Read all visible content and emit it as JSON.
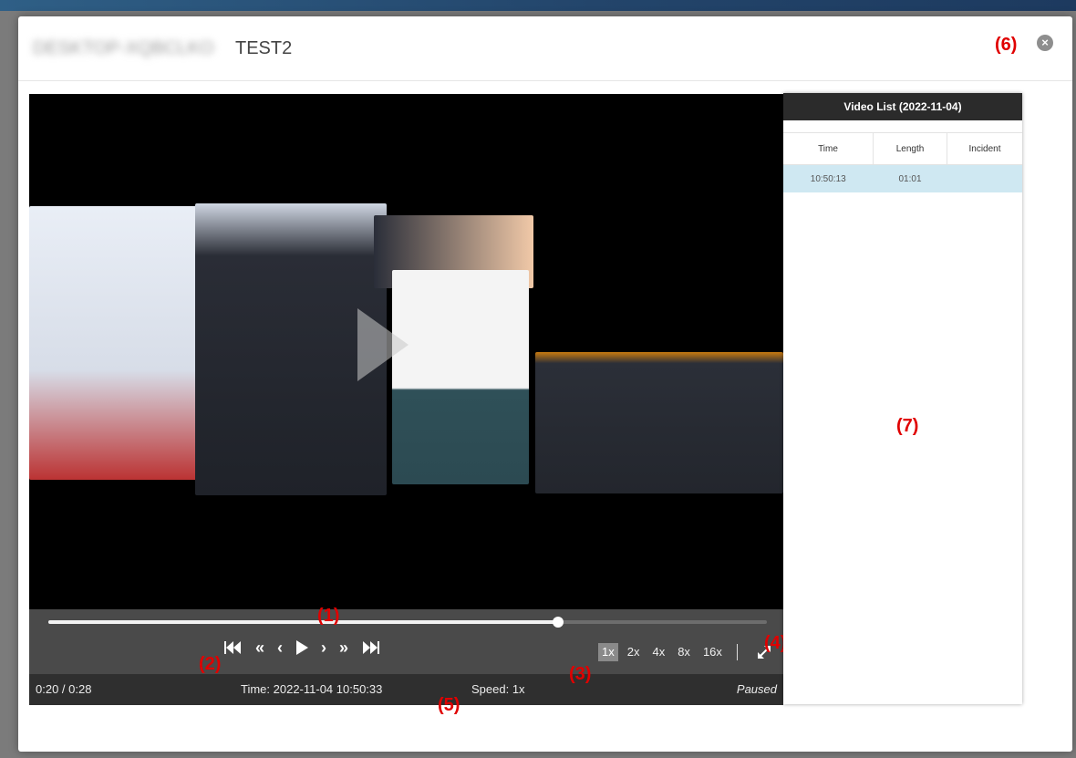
{
  "modal": {
    "computer_name": "DESKTOP-XQBCLKO",
    "title": "TEST2",
    "close_icon": "close-icon"
  },
  "callouts": {
    "c1": "(1)",
    "c2": "(2)",
    "c3": "(3)",
    "c4": "(4)",
    "c5": "(5)",
    "c6": "(6)",
    "c7": "(7)"
  },
  "player": {
    "progress": 0.71,
    "transport": [
      "skip-to-start-icon",
      "rewind-icon",
      "step-back-icon",
      "play-icon",
      "step-forward-icon",
      "fast-forward-icon",
      "skip-to-end-icon"
    ],
    "speeds": [
      "1x",
      "2x",
      "4x",
      "8x",
      "16x"
    ],
    "active_speed": "1x",
    "fullscreen_icon": "expand-icon",
    "status": {
      "elapsed": "0:20 / 0:28",
      "time": "Time: 2022-11-04 10:50:33",
      "speed": "Speed: 1x",
      "state": "Paused"
    }
  },
  "video_list": {
    "title": "Video List  (2022-11-04)",
    "columns": [
      "Time",
      "Length",
      "Incident"
    ],
    "rows": [
      {
        "time": "10:50:13",
        "length": "01:01",
        "incident": ""
      }
    ]
  },
  "colors": {
    "accent_callout": "#e00000",
    "selected_row": "#cfe8f2",
    "controls_bg": "#4a4a4a"
  }
}
